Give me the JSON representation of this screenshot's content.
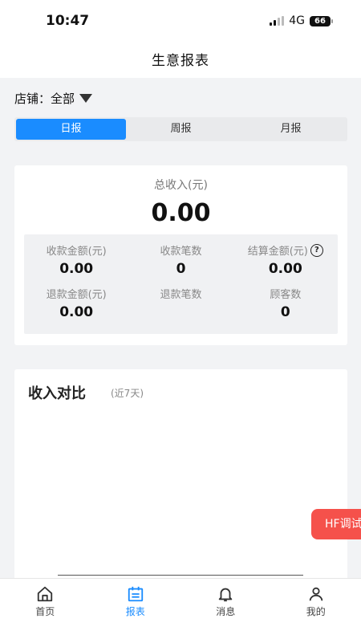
{
  "status": {
    "time": "10:47",
    "network": "4G",
    "battery": "66"
  },
  "nav": {
    "title": "生意报表"
  },
  "store": {
    "label": "店铺：",
    "value": "全部"
  },
  "periods": [
    {
      "label": "日报",
      "active": true
    },
    {
      "label": "周报",
      "active": false
    },
    {
      "label": "月报",
      "active": false
    }
  ],
  "summary": {
    "total_label": "总收入(元)",
    "total_value": "0.00",
    "metrics": [
      {
        "label": "收款金额(元)",
        "value": "0.00"
      },
      {
        "label": "收款笔数",
        "value": "0"
      },
      {
        "label": "结算金额(元)",
        "value": "0.00",
        "help": "?"
      },
      {
        "label": "退款金额(元)",
        "value": "0.00"
      },
      {
        "label": "退款笔数",
        "value": ""
      },
      {
        "label": "顾客数",
        "value": "0"
      }
    ]
  },
  "compare": {
    "title": "收入对比",
    "subtitle": "(近7天)"
  },
  "float_tag": "HF调试",
  "tabs": [
    {
      "label": "首页",
      "icon": "home-icon",
      "active": false
    },
    {
      "label": "报表",
      "icon": "calendar-report-icon",
      "active": true
    },
    {
      "label": "消息",
      "icon": "bell-icon",
      "active": false
    },
    {
      "label": "我的",
      "icon": "user-icon",
      "active": false
    }
  ],
  "colors": {
    "accent": "#1a8cff",
    "float_tag": "#f5514b",
    "background": "#f2f3f5"
  }
}
